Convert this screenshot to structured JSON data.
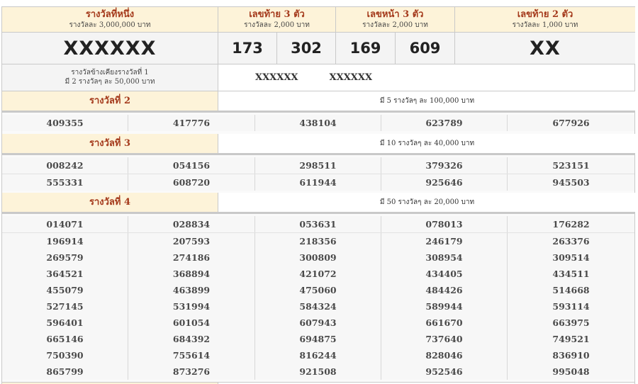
{
  "first": {
    "title": "รางวัลที่หนึ่ง",
    "sub": "รางวัลละ 3,000,000 บาท",
    "number": "XXXXXX"
  },
  "last3": {
    "title": "เลขท้าย 3 ตัว",
    "sub": "รางวัลละ 2,000 บาท",
    "numbers": [
      "173",
      "302"
    ]
  },
  "front3": {
    "title": "เลขหน้า 3 ตัว",
    "sub": "รางวัลละ 2,000 บาท",
    "numbers": [
      "169",
      "609"
    ]
  },
  "last2": {
    "title": "เลขท้าย 2 ตัว",
    "sub": "รางวัลละ 1,000 บาท",
    "number": "XX"
  },
  "near": {
    "label1": "รางวัลข้างเคียงรางวัลที่ 1",
    "label2": "มี 2 รางวัลๆ ละ 50,000 บาท",
    "numbers": [
      "XXXXXX",
      "XXXXXX"
    ]
  },
  "prize2": {
    "name": "รางวัลที่ 2",
    "info": "มี 5 รางวัลๆ ละ 100,000 บาท",
    "rows": [
      [
        "409355",
        "417776",
        "438104",
        "623789",
        "677926"
      ]
    ]
  },
  "prize3": {
    "name": "รางวัลที่ 3",
    "info": "มี 10 รางวัลๆ ละ 40,000 บาท",
    "rows": [
      [
        "008242",
        "054156",
        "298511",
        "379326",
        "523151"
      ],
      [
        "555331",
        "608720",
        "611944",
        "925646",
        "945503"
      ]
    ]
  },
  "prize4": {
    "name": "รางวัลที่ 4",
    "info": "มี 50 รางวัลๆ ละ 20,000 บาท",
    "rows": [
      [
        "014071",
        "028834",
        "053631",
        "078013",
        "176282"
      ],
      [
        "196914",
        "207593",
        "218356",
        "246179",
        "263376"
      ],
      [
        "269579",
        "274186",
        "300809",
        "308954",
        "309514"
      ],
      [
        "364521",
        "368894",
        "421072",
        "434405",
        "434511"
      ],
      [
        "455079",
        "463899",
        "475060",
        "484426",
        "514668"
      ],
      [
        "527145",
        "531994",
        "584324",
        "589944",
        "593114"
      ],
      [
        "596401",
        "601054",
        "607943",
        "661670",
        "663975"
      ],
      [
        "665146",
        "684392",
        "694875",
        "737640",
        "749521"
      ],
      [
        "750390",
        "755614",
        "816244",
        "828046",
        "836910"
      ],
      [
        "865799",
        "873276",
        "921508",
        "952546",
        "995048"
      ]
    ]
  }
}
